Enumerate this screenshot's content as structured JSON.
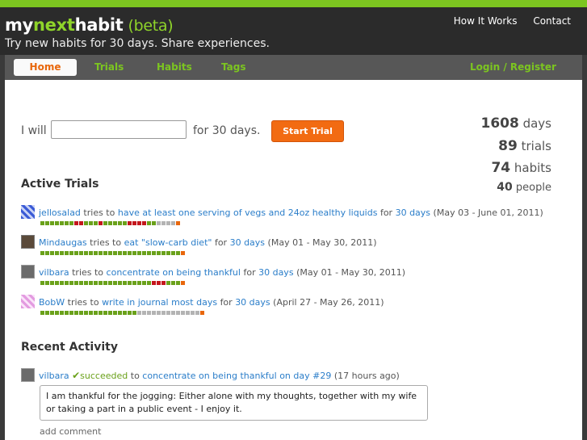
{
  "header": {
    "logo_my": "my",
    "logo_next": "next",
    "logo_habit": "habit",
    "logo_beta": "(beta)",
    "tagline": "Try new habits for 30 days. Share experiences.",
    "links": [
      "How It Works",
      "Contact"
    ]
  },
  "nav": {
    "tabs": [
      "Home",
      "Trials",
      "Habits",
      "Tags"
    ],
    "login": "Login / Register"
  },
  "form": {
    "prefix": "I will",
    "input_value": "",
    "suffix": "for 30 days.",
    "button": "Start Trial"
  },
  "stats": [
    {
      "number": "1608",
      "label": "days"
    },
    {
      "number": "89",
      "label": "trials"
    },
    {
      "number": "74",
      "label": "habits"
    },
    {
      "number": "40",
      "label": "people"
    }
  ],
  "active_trials": {
    "heading": "Active Trials",
    "items": [
      {
        "user": "jellosalad",
        "verb": "tries to",
        "habit": "have at least one serving of vegs and 24oz healthy liquids",
        "for": "for",
        "duration": "30 days",
        "dates": "(May 03 - June 01, 2011)",
        "progress": "dddddddffdddfdddddffffddppppt"
      },
      {
        "user": "Mindaugas",
        "verb": "tries to",
        "habit": "eat \"slow-carb diet\"",
        "for": "for",
        "duration": "30 days",
        "dates": "(May 01 - May 30, 2011)",
        "progress": "dddddddddddddddddddddddddddddt"
      },
      {
        "user": "vilbara",
        "verb": "tries to",
        "habit": "concentrate on being thankful",
        "for": "for",
        "duration": "30 days",
        "dates": "(May 01 - May 30, 2011)",
        "progress": "dddddddddddddddddddddddfffdddt"
      },
      {
        "user": "BobW",
        "verb": "tries to",
        "habit": "write in journal most days",
        "for": "for",
        "duration": "30 days",
        "dates": "(April 27 - May 26, 2011)",
        "progress": "ddddddddddddddddddddpppppppppppppt"
      }
    ]
  },
  "recent_activity": {
    "heading": "Recent Activity",
    "user": "vilbara",
    "action": "succeeded",
    "to": "to",
    "target": "concentrate on being thankful on day #29",
    "time": "(17 hours ago)",
    "comment": "I am thankful for the jogging: Either alone with my thoughts, together with my wife or taking a part in a public event - I enjoy it.",
    "add_comment": "add comment"
  },
  "colors": {
    "accent_green": "#7cc520",
    "accent_orange": "#f26b12",
    "link_blue": "#2a7dc9",
    "fail_red": "#c4161c"
  }
}
